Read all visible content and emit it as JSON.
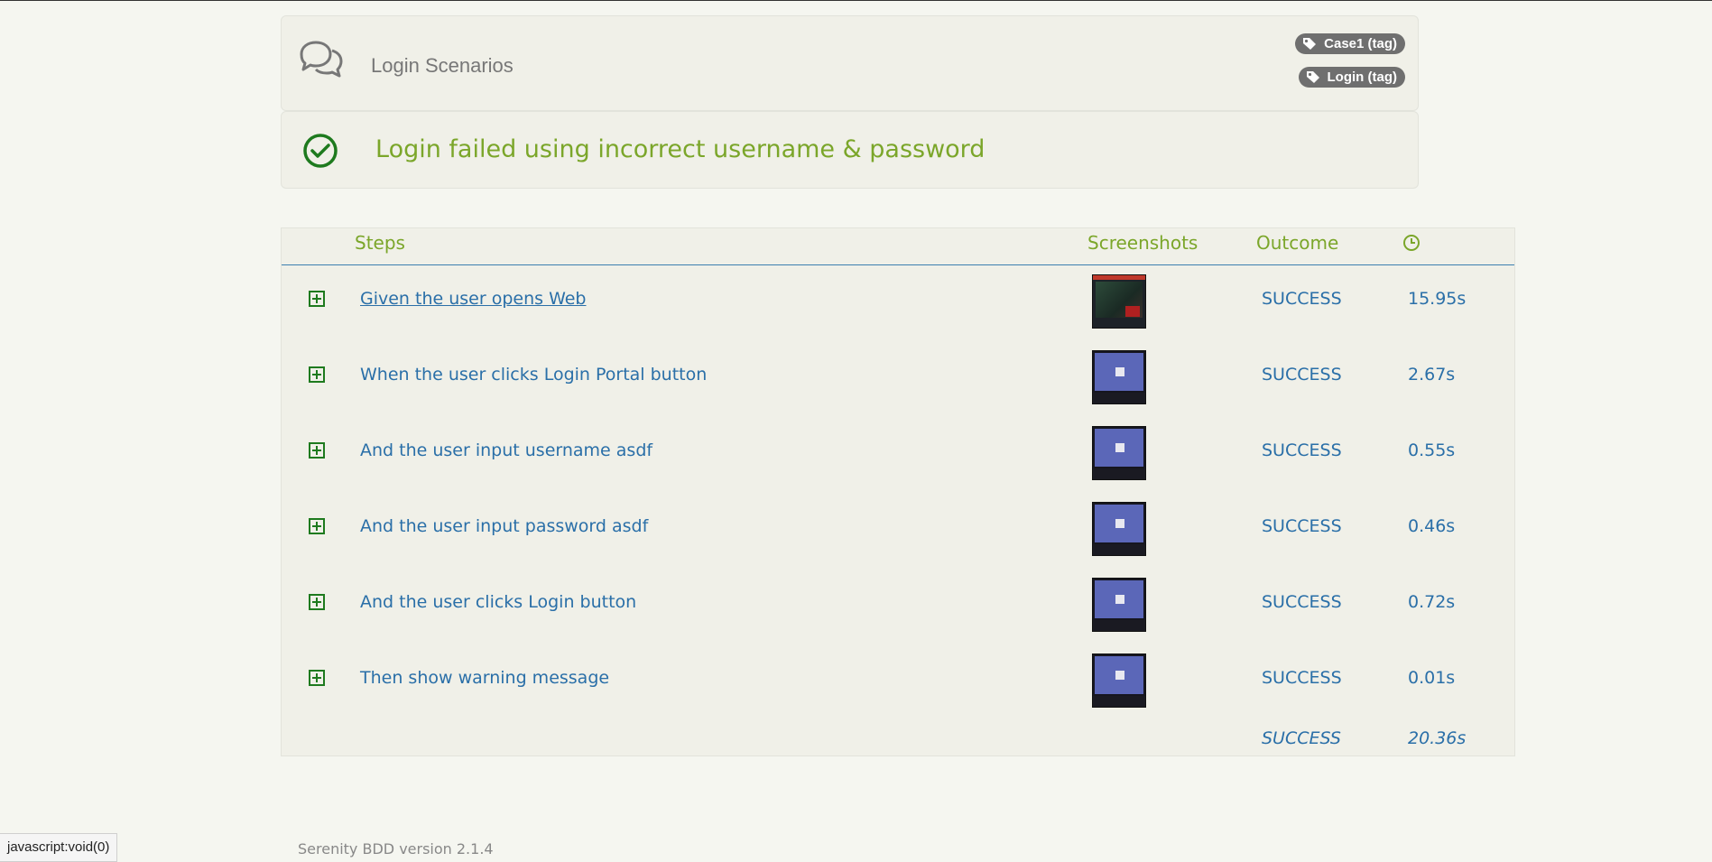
{
  "story": {
    "title": "Login Scenarios",
    "tags": [
      "Case1 (tag)",
      "Login (tag)"
    ]
  },
  "scenario": {
    "title": "Login failed using incorrect username & password",
    "status_icon": "check-circle-icon"
  },
  "table": {
    "headers": {
      "steps": "Steps",
      "screenshots": "Screenshots",
      "outcome": "Outcome",
      "duration_icon": "clock-icon"
    },
    "rows": [
      {
        "step": "Given the user opens Web",
        "outcome": "SUCCESS",
        "duration": "15.95s"
      },
      {
        "step": "When the user clicks Login Portal button",
        "outcome": "SUCCESS",
        "duration": "2.67s"
      },
      {
        "step": "And the user input username asdf",
        "outcome": "SUCCESS",
        "duration": "0.55s"
      },
      {
        "step": "And the user input password asdf",
        "outcome": "SUCCESS",
        "duration": "0.46s"
      },
      {
        "step": "And the user clicks Login button",
        "outcome": "SUCCESS",
        "duration": "0.72s"
      },
      {
        "step": "Then show warning message",
        "outcome": "SUCCESS",
        "duration": "0.01s"
      }
    ],
    "total": {
      "outcome": "SUCCESS",
      "duration": "20.36s"
    }
  },
  "footer": {
    "version": "Serenity BDD version 2.1.4"
  },
  "status_bar": {
    "url": "javascript:void(0)"
  },
  "colors": {
    "accent_green": "#7ba62a",
    "link_blue": "#2a6fa8",
    "success_green": "#1e7a1e",
    "tag_bg": "#6f6f6f"
  }
}
